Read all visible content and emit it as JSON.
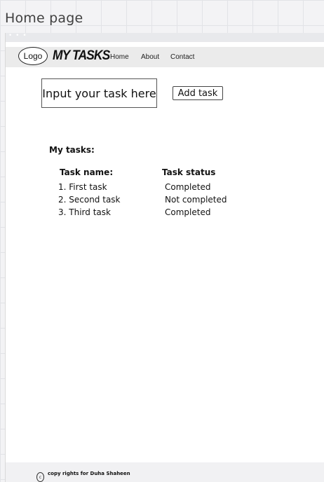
{
  "canvas": {
    "frame_title": "Home page"
  },
  "navbar": {
    "logo": "Logo",
    "brand": "MY TASKS",
    "links": [
      "Home",
      "About",
      "Contact"
    ]
  },
  "form": {
    "input_placeholder": "Input your task here",
    "add_button": "Add task"
  },
  "tasks": {
    "heading": "My tasks:",
    "columns": [
      "Task name:",
      "Task status"
    ],
    "rows": [
      {
        "name": "1. First task",
        "status": "Completed"
      },
      {
        "name": "2. Second task",
        "status": "Not completed"
      },
      {
        "name": "3. Third task",
        "status": "Completed"
      }
    ]
  },
  "footer": {
    "icon": "copyright-icon",
    "text": "copy rights for Duha Shaheen"
  }
}
